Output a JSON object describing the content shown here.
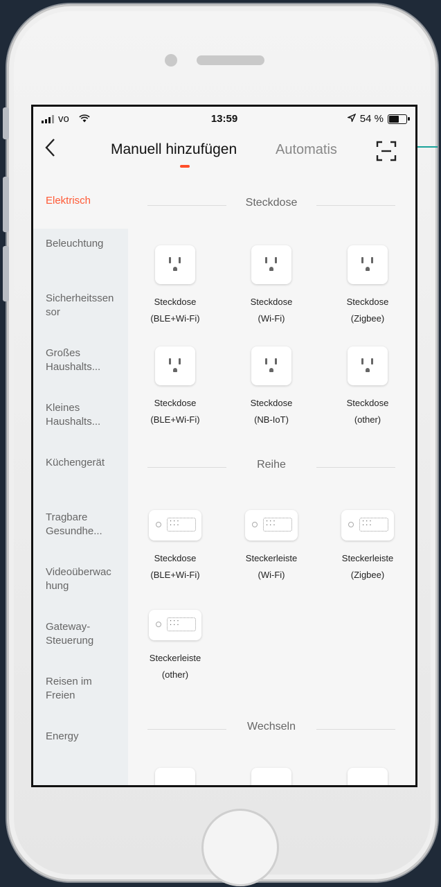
{
  "status_bar": {
    "carrier": "vo",
    "time": "13:59",
    "battery": "54 %",
    "battery_level": 0.54
  },
  "nav": {
    "back_icon": "chevron-left-icon",
    "tab_manual": "Manuell hinzufügen",
    "tab_auto": "Automatis",
    "scan_icon": "scan-icon"
  },
  "sidebar": {
    "items": [
      {
        "label": "Elektrisch",
        "active": true
      },
      {
        "label": "Beleuchtung"
      },
      {
        "label": "Sicherheitssensor"
      },
      {
        "label": "Großes Haushalts..."
      },
      {
        "label": "Kleines Haushalts..."
      },
      {
        "label": "Küchengerät"
      },
      {
        "label": "Tragbare Gesundhe..."
      },
      {
        "label": "Videoüberwachung"
      },
      {
        "label": "Gateway-Steuerung"
      },
      {
        "label": "Reisen im Freien"
      },
      {
        "label": "Energy"
      }
    ]
  },
  "sections": [
    {
      "title": "Steckdose",
      "devices": [
        {
          "name": "Steckdose",
          "variant": "(BLE+Wi-Fi)"
        },
        {
          "name": "Steckdose",
          "variant": "(Wi-Fi)"
        },
        {
          "name": "Steckdose",
          "variant": "(Zigbee)"
        },
        {
          "name": "Steckdose",
          "variant": "(BLE+Wi-Fi)"
        },
        {
          "name": "Steckdose",
          "variant": "(NB-IoT)"
        },
        {
          "name": "Steckdose",
          "variant": "(other)"
        }
      ]
    },
    {
      "title": "Reihe",
      "devices": [
        {
          "name": "Steckdose",
          "variant": "(BLE+Wi-Fi)"
        },
        {
          "name": "Steckerleiste",
          "variant": "(Wi-Fi)"
        },
        {
          "name": "Steckerleiste",
          "variant": "(Zigbee)"
        },
        {
          "name": "Steckerleiste",
          "variant": "(other)"
        }
      ]
    },
    {
      "title": "Wechseln",
      "devices": []
    }
  ],
  "colors": {
    "accent": "#ff4e2a",
    "sidebar_bg": "#eceff1",
    "callout": "#1aa39a"
  }
}
